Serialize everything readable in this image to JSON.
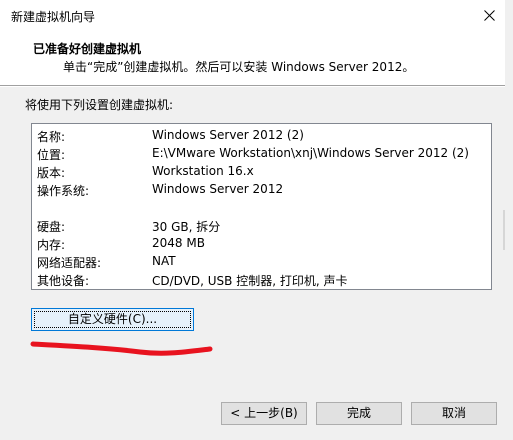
{
  "window": {
    "title": "新建虚拟机向导",
    "close_glyph": "✕"
  },
  "header": {
    "title": "已准备好创建虚拟机",
    "subtitle": "单击“完成”创建虚拟机。然后可以安装 Windows Server 2012。"
  },
  "prompt": "将使用下列设置创建虚拟机:",
  "summary": {
    "name": {
      "key": "名称:",
      "value": "Windows Server 2012 (2)"
    },
    "location": {
      "key": "位置:",
      "value": "E:\\VMware Workstation\\xnj\\Windows Server 2012 (2)"
    },
    "version": {
      "key": "版本:",
      "value": "Workstation 16.x"
    },
    "os": {
      "key": "操作系统:",
      "value": "Windows Server 2012"
    },
    "disk": {
      "key": "硬盘:",
      "value": "30 GB, 拆分"
    },
    "memory": {
      "key": "内存:",
      "value": "2048 MB"
    },
    "network": {
      "key": "网络适配器:",
      "value": "NAT"
    },
    "other": {
      "key": "其他设备:",
      "value": "CD/DVD, USB 控制器, 打印机, 声卡"
    }
  },
  "buttons": {
    "customize": "自定义硬件(C)...",
    "back": "< 上一步(B)",
    "finish": "完成",
    "cancel": "取消"
  },
  "colors": {
    "accent": "#0078d7",
    "scribble": "#e8131f"
  }
}
